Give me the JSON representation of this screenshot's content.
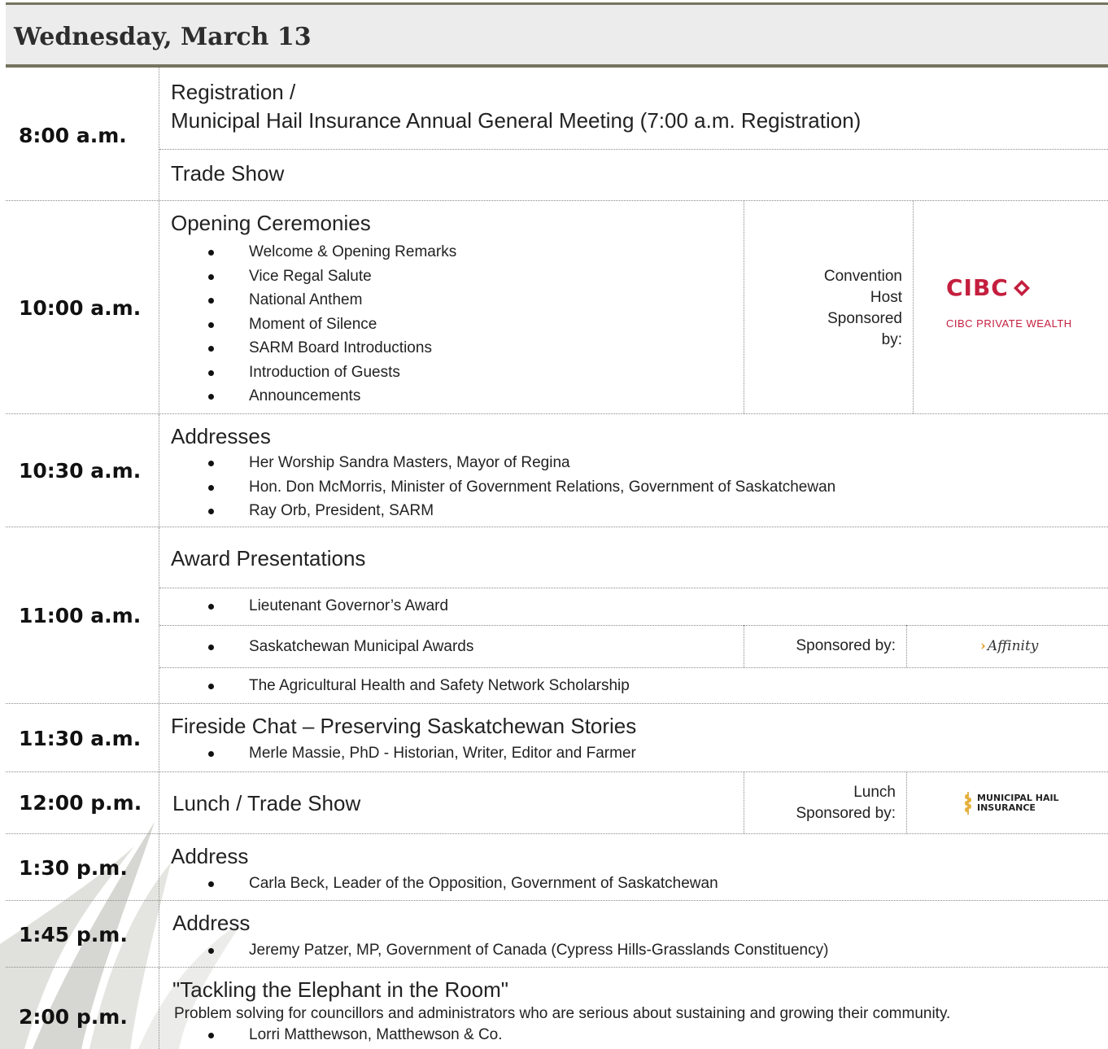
{
  "header": {
    "title": "Wednesday, March 13"
  },
  "colors": {
    "header_bg": "#ececec",
    "header_border": "#75735f",
    "cibc_red": "#c41f3e",
    "affinity_orange": "#e89b1e",
    "decoration": "#d8d8d4"
  },
  "rows": [
    {
      "time": "8:00 a.m.",
      "line1": "Registration /",
      "line2": "Municipal Hail Insurance Annual General Meeting (7:00 a.m. Registration)",
      "sub": "Trade Show"
    },
    {
      "time": "10:00 a.m.",
      "heading": "Opening Ceremonies",
      "bullets": [
        "Welcome & Opening Remarks",
        "Vice Regal Salute",
        "National Anthem",
        "Moment of Silence",
        "SARM Board Introductions",
        "Introduction of Guests",
        "Announcements"
      ],
      "sponsor_label": [
        "Convention",
        "Host",
        "Sponsored",
        "by:"
      ],
      "logo": {
        "name": "CIBC",
        "sub": "CIBC PRIVATE WEALTH",
        "icon": "cibc-diamond-icon"
      }
    },
    {
      "time": "10:30 a.m.",
      "heading": "Addresses",
      "bullets": [
        "Her Worship Sandra Masters, Mayor of Regina",
        "Hon. Don McMorris, Minister of Government Relations, Government of Saskatchewan",
        "Ray Orb, President, SARM"
      ]
    },
    {
      "time": "11:00 a.m.",
      "heading": "Award Presentations",
      "items": [
        "Lieutenant Governor’s Award",
        "Saskatchewan Municipal Awards",
        "The Agricultural Health and Safety Network Scholarship"
      ],
      "sponsor_label": "Sponsored by:",
      "logo": {
        "name": "Affinity",
        "icon": "affinity-chevron-icon"
      }
    },
    {
      "time": "11:30 a.m.",
      "heading": "Fireside Chat – Preserving Saskatchewan Stories",
      "bullets": [
        "Merle Massie, PhD - Historian, Writer, Editor and Farmer"
      ]
    },
    {
      "time": "12:00 p.m.",
      "heading": "Lunch / Trade Show",
      "sponsor_label": [
        "Lunch",
        "Sponsored by:"
      ],
      "logo": {
        "line1": "MUNICIPAL HAIL",
        "line2": "INSURANCE",
        "icon": "wheat-icon"
      }
    },
    {
      "time": "1:30 p.m.",
      "heading": "Address",
      "bullets": [
        "Carla Beck, Leader of the Opposition, Government of Saskatchewan"
      ]
    },
    {
      "time": "1:45 p.m.",
      "heading": "Address",
      "bullets": [
        "Jeremy Patzer, MP, Government of Canada (Cypress Hills-Grasslands Constituency)"
      ]
    },
    {
      "time": "2:00 p.m.",
      "heading": "\"Tackling the Elephant in the Room\"",
      "description": "Problem solving for councillors and administrators who are serious about sustaining and growing their community.",
      "bullets": [
        "Lorri Matthewson, Matthewson & Co."
      ]
    }
  ]
}
